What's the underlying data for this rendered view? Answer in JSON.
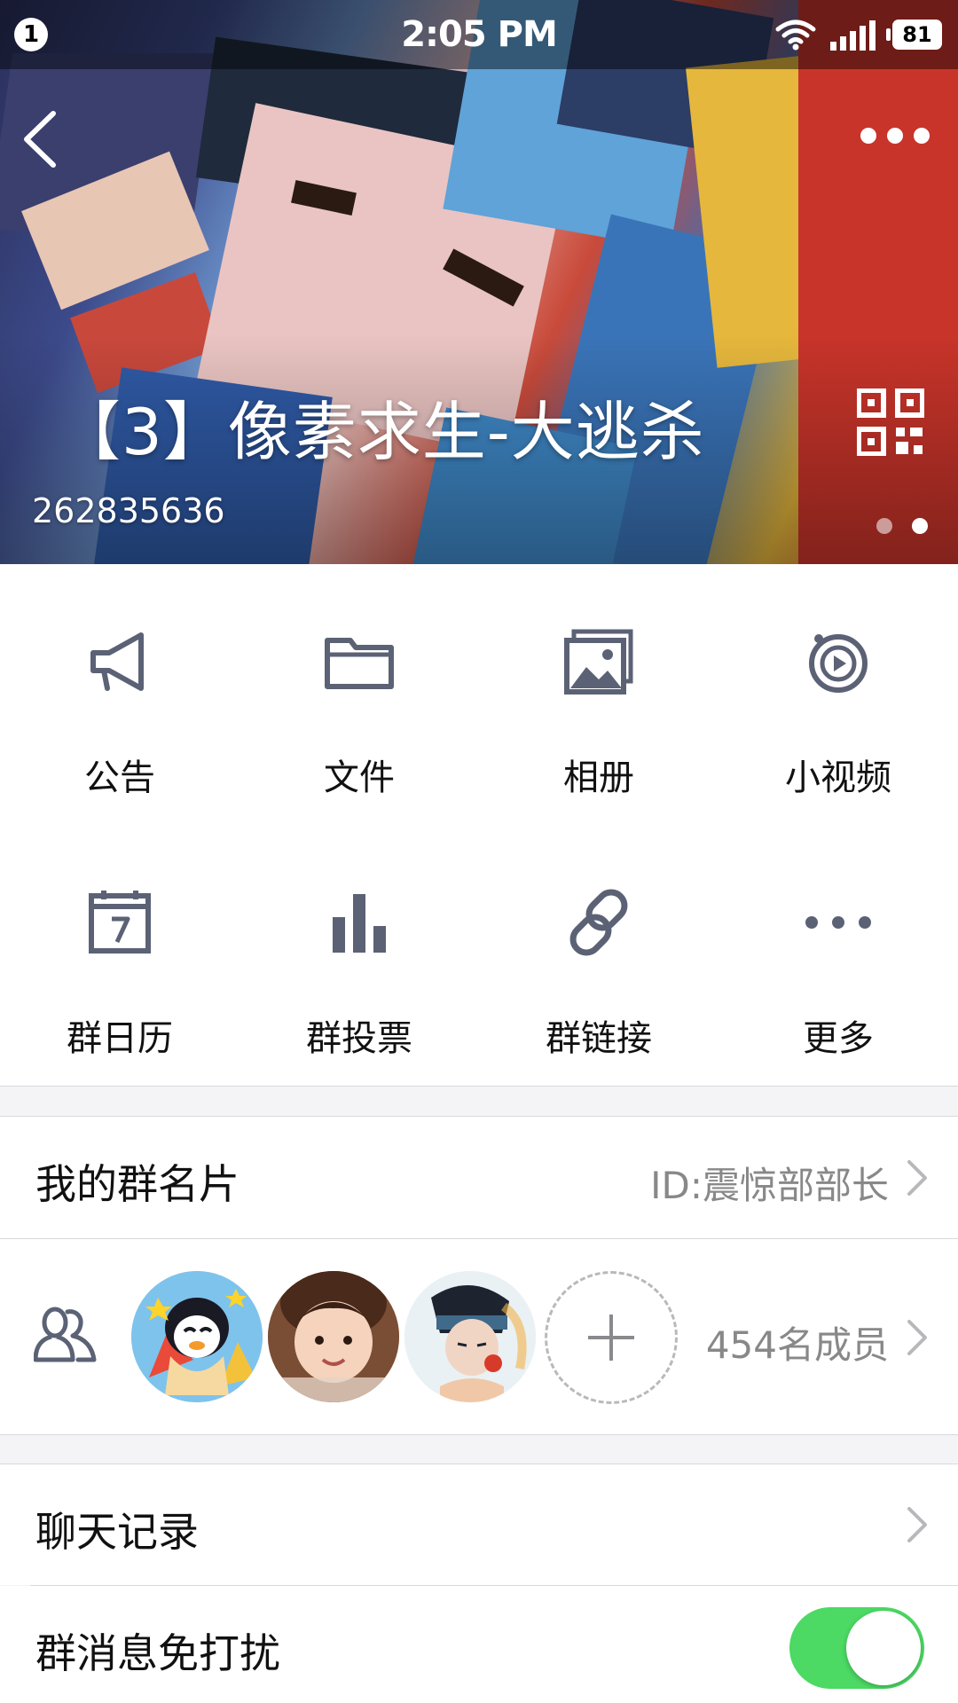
{
  "status_bar": {
    "notification_count": "1",
    "time": "2:05 PM",
    "battery": "81"
  },
  "header": {
    "group_name": "【3】像素求生-大逃杀",
    "group_number": "262835636",
    "carousel_pages": 2,
    "carousel_active_index": 1
  },
  "features": [
    {
      "label": "公告",
      "icon": "megaphone-icon"
    },
    {
      "label": "文件",
      "icon": "folder-icon"
    },
    {
      "label": "相册",
      "icon": "photo-album-icon"
    },
    {
      "label": "小视频",
      "icon": "video-icon"
    },
    {
      "label": "群日历",
      "icon": "calendar-icon"
    },
    {
      "label": "群投票",
      "icon": "bar-chart-icon"
    },
    {
      "label": "群链接",
      "icon": "link-icon"
    },
    {
      "label": "更多",
      "icon": "more-dots-icon"
    }
  ],
  "group_card": {
    "label": "我的群名片",
    "value": "ID:震惊部部长"
  },
  "members": {
    "count_label": "454名成员",
    "avatars": [
      "penguin-avatar",
      "child-photo-avatar",
      "anime-boy-avatar"
    ]
  },
  "chat_history": {
    "label": "聊天记录"
  },
  "do_not_disturb": {
    "label": "群消息免打扰",
    "enabled": true
  },
  "colors": {
    "icon_gray": "#5c6275",
    "toggle_on": "#4cd964",
    "secondary_text": "#888888"
  }
}
